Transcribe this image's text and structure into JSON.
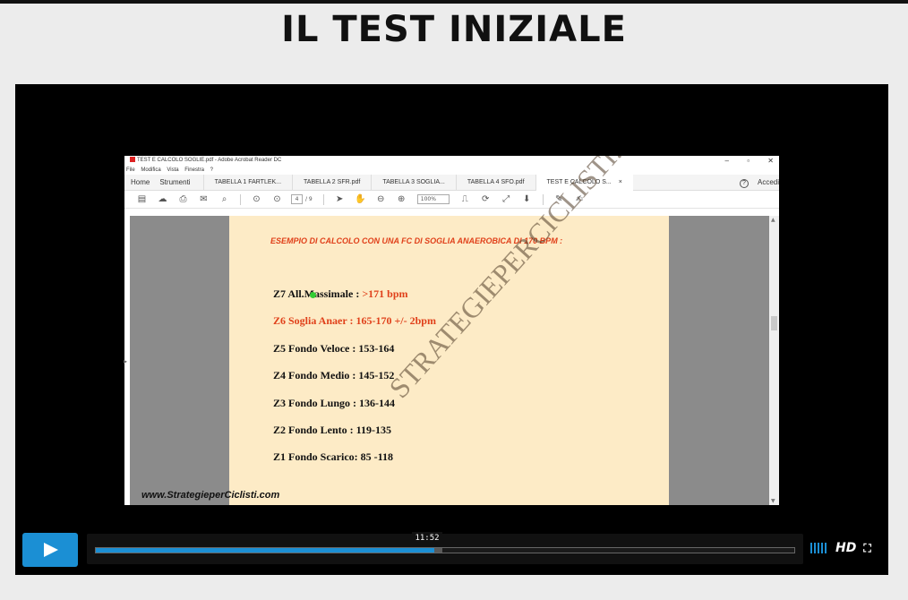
{
  "page": {
    "title": "IL TEST INIZIALE"
  },
  "app": {
    "window_title": "TEST E CALCOLO SOGLIE.pdf - Adobe Acrobat Reader DC",
    "window_controls": [
      "–",
      "▫",
      "✕"
    ],
    "menu": [
      "File",
      "Modifica",
      "Vista",
      "Finestra",
      "?"
    ],
    "tabs": {
      "home": "Home",
      "tools": "Strumenti",
      "documents": [
        "TABELLA 1 FARTLEK...",
        "TABELLA 2 SFR.pdf",
        "TABELLA 3 SOGLIA...",
        "TABELLA 4 SFO.pdf",
        "TEST E CALCOLO S..."
      ],
      "active_index": 4,
      "close_glyph": "×",
      "help_glyph": "?",
      "access": "Accedi"
    },
    "toolbar": {
      "page_current": "4",
      "page_total": "/ 9",
      "zoom": "100%"
    }
  },
  "document": {
    "heading": "ESEMPIO DI CALCOLO CON UNA FC DI SOGLIA ANAEROBICA DI 170 BPM :",
    "zones": [
      {
        "label": "Z7 All.Massimale : ",
        "value": ">171 bpm",
        "highlight": true
      },
      {
        "label": "Z6 Soglia Anaer :  165-170  +/- 2bpm",
        "value": "",
        "highlight": true
      },
      {
        "label": "Z5 Fondo Veloce : 153-164",
        "value": ""
      },
      {
        "label": "Z4 Fondo Medio :  145-152",
        "value": ""
      },
      {
        "label": "Z3 Fondo Lungo :  136-144",
        "value": ""
      },
      {
        "label": "Z2 Fondo Lento :   119-135",
        "value": ""
      },
      {
        "label": "Z1 Fondo Scarico:  85 -118",
        "value": ""
      }
    ],
    "watermark": "STRATEGIEPERCICLISTI.COM",
    "website": "www.StrategieperCiclisti.com"
  },
  "player": {
    "time": "11:52",
    "progress": 0.485,
    "buffered": 0.496,
    "hd_label": "HD",
    "colors": {
      "accent": "#1b8fd4"
    }
  }
}
